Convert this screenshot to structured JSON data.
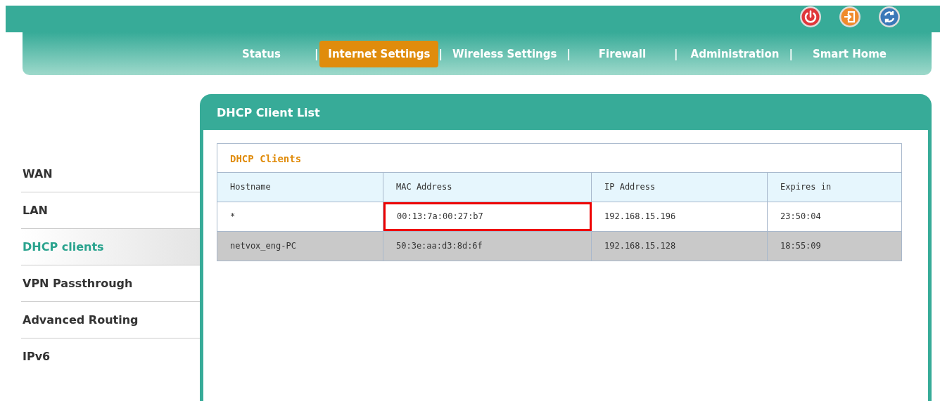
{
  "top_icons": [
    {
      "kind": "power"
    },
    {
      "kind": "logout"
    },
    {
      "kind": "refresh"
    }
  ],
  "nav": [
    {
      "kind": "tab",
      "label": "Status",
      "selected": false
    },
    {
      "kind": "separator",
      "label": "|"
    },
    {
      "kind": "tab",
      "label": "Internet Settings",
      "selected": true
    },
    {
      "kind": "separator",
      "label": "|"
    },
    {
      "kind": "tab",
      "label": "Wireless Settings",
      "selected": false
    },
    {
      "kind": "separator",
      "label": "|"
    },
    {
      "kind": "tab",
      "label": "Firewall",
      "selected": false
    },
    {
      "kind": "separator",
      "label": "|"
    },
    {
      "kind": "tab",
      "label": "Administration",
      "selected": false
    },
    {
      "kind": "separator",
      "label": "|"
    },
    {
      "kind": "tab",
      "label": "Smart Home",
      "selected": false
    }
  ],
  "sidebar": {
    "items": [
      {
        "label": "WAN",
        "selected": false
      },
      {
        "label": "LAN",
        "selected": false
      },
      {
        "label": "DHCP clients",
        "selected": true
      },
      {
        "label": "VPN Passthrough",
        "selected": false
      },
      {
        "label": "Advanced Routing",
        "selected": false
      },
      {
        "label": "IPv6",
        "selected": false
      }
    ]
  },
  "panel": {
    "title": "DHCP Client List",
    "table": {
      "title": "DHCP Clients",
      "columns": [
        "Hostname",
        "MAC Address",
        "IP Address",
        "Expires in"
      ],
      "rows": [
        {
          "highlighted": false,
          "cells": [
            {
              "text": "*",
              "outlined": false
            },
            {
              "text": "00:13:7a:00:27:b7",
              "outlined": true
            },
            {
              "text": "192.168.15.196",
              "outlined": false
            },
            {
              "text": "23:50:04",
              "outlined": false
            }
          ]
        },
        {
          "highlighted": true,
          "cells": [
            {
              "text": "netvox_eng-PC",
              "outlined": false
            },
            {
              "text": "50:3e:aa:d3:8d:6f",
              "outlined": false
            },
            {
              "text": "192.168.15.128",
              "outlined": false
            },
            {
              "text": "18:55:09",
              "outlined": false
            }
          ]
        }
      ]
    }
  }
}
